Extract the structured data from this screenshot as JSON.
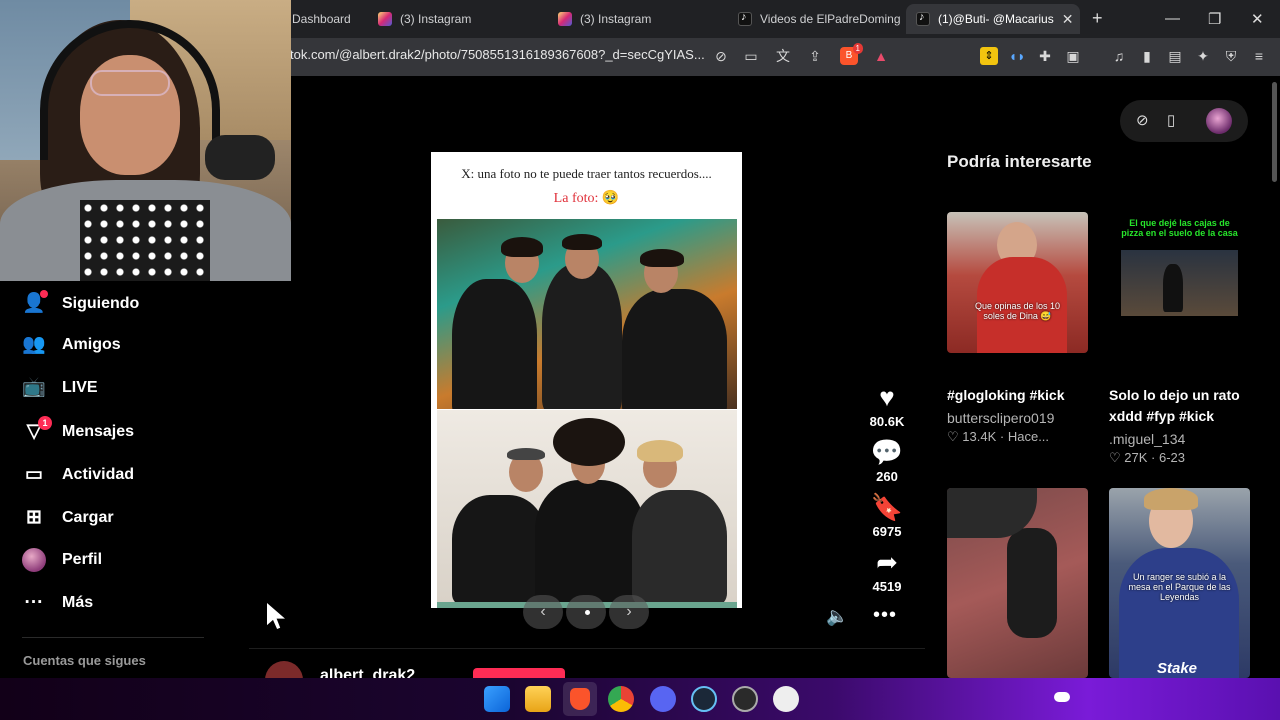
{
  "browser": {
    "tabs": [
      {
        "label": "Dashboard",
        "favicon": "dashboard-icon"
      },
      {
        "label": "(3) Instagram",
        "favicon": "instagram-icon"
      },
      {
        "label": "(3) Instagram",
        "favicon": "instagram-icon"
      },
      {
        "label": "Videos de ElPadreDoming",
        "favicon": "tiktok-icon"
      },
      {
        "label": "(1)@Buti- @Macarius",
        "favicon": "tiktok-icon",
        "active": true
      }
    ],
    "url": "tok.com/@albert.drak2/photo/7508551316189367608?_d=secCgYIAS...",
    "shields_badge": "1"
  },
  "nav": {
    "items": [
      {
        "label": "Siguiendo",
        "icon": "following-icon",
        "badge": ""
      },
      {
        "label": "Amigos",
        "icon": "friends-icon",
        "badge": ""
      },
      {
        "label": "LIVE",
        "icon": "live-icon",
        "badge": ""
      },
      {
        "label": "Mensajes",
        "icon": "messages-icon",
        "badge": "1"
      },
      {
        "label": "Actividad",
        "icon": "activity-icon",
        "badge": ""
      },
      {
        "label": "Cargar",
        "icon": "upload-icon",
        "badge": ""
      },
      {
        "label": "Perfil",
        "icon": "profile-avatar",
        "badge": ""
      },
      {
        "label": "Más",
        "icon": "more-icon",
        "badge": ""
      }
    ],
    "following_heading": "Cuentas que sigues"
  },
  "post": {
    "caption_line1": "X: una foto no te puede traer tantos recuerdos....",
    "caption_line2": "La foto: 🥹",
    "likes": "80.6K",
    "comments": "260",
    "saves": "6975",
    "shares": "4519",
    "author": "albert_drak2"
  },
  "recommendations": {
    "title": "Podría interesarte",
    "items": [
      {
        "caption": "#glogloking #kick",
        "user": "buttersclipero019",
        "likes": "13.4K",
        "date": "Hace...",
        "overlay": "Que opinas de los 10 soles de Dina 😅"
      },
      {
        "caption": "Solo lo dejo un rato xddd #fyp #kick",
        "user": ".miguel_134",
        "likes": "27K",
        "date": "6-23",
        "overlay": "El que dejé las cajas de pizza en el suelo de la casa"
      },
      {
        "caption": "",
        "user": "",
        "likes": "",
        "date": "",
        "overlay": ""
      },
      {
        "caption": "",
        "user": "",
        "likes": "",
        "date": "",
        "overlay": "Un ranger se subió a la mesa en el Parque de las Leyendas",
        "logo": "Stake"
      }
    ]
  },
  "colors": {
    "accent": "#fe2c55",
    "background": "#000000"
  }
}
